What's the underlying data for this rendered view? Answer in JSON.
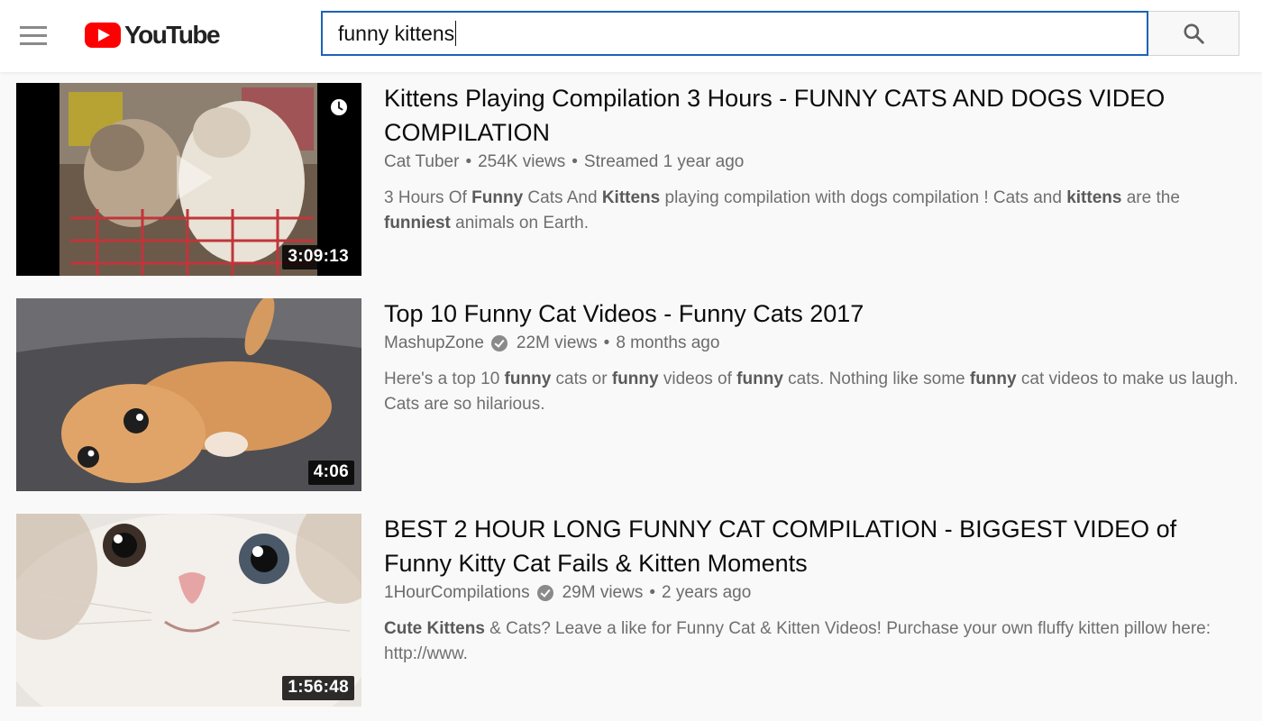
{
  "header": {
    "logo_text": "YouTube",
    "search_value": "funny kittens"
  },
  "results": [
    {
      "title": "Kittens Playing Compilation 3 Hours - FUNNY CATS AND DOGS VIDEO COMPILATION",
      "channel": "Cat Tuber",
      "verified": false,
      "views": "254K views",
      "age": "Streamed 1 year ago",
      "duration": "3:09:13",
      "description": [
        {
          "t": "3 Hours Of ",
          "b": false
        },
        {
          "t": "Funny",
          "b": true
        },
        {
          "t": " Cats And ",
          "b": false
        },
        {
          "t": "Kittens",
          "b": true
        },
        {
          "t": " playing compilation with dogs compilation ! Cats and ",
          "b": false
        },
        {
          "t": "kittens",
          "b": true
        },
        {
          "t": " are the ",
          "b": false
        },
        {
          "t": "funniest",
          "b": true
        },
        {
          "t": " animals on Earth.",
          "b": false
        }
      ]
    },
    {
      "title": "Top 10 Funny Cat Videos - Funny Cats 2017",
      "channel": "MashupZone",
      "verified": true,
      "views": "22M views",
      "age": "8 months ago",
      "duration": "4:06",
      "description": [
        {
          "t": "Here's a top 10 ",
          "b": false
        },
        {
          "t": "funny",
          "b": true
        },
        {
          "t": " cats or ",
          "b": false
        },
        {
          "t": "funny",
          "b": true
        },
        {
          "t": " videos of ",
          "b": false
        },
        {
          "t": "funny",
          "b": true
        },
        {
          "t": " cats. Nothing like some ",
          "b": false
        },
        {
          "t": "funny",
          "b": true
        },
        {
          "t": " cat videos to make us laugh. Cats are so hilarious.",
          "b": false
        }
      ]
    },
    {
      "title": "BEST 2 HOUR LONG FUNNY CAT COMPILATION - BIGGEST VIDEO of Funny Kitty Cat Fails & Kitten Moments",
      "channel": "1HourCompilations",
      "verified": true,
      "views": "29M views",
      "age": "2 years ago",
      "duration": "1:56:48",
      "description": [
        {
          "t": "Cute Kittens",
          "b": true
        },
        {
          "t": " & Cats? Leave a like for Funny Cat & Kitten Videos! Purchase your own fluffy kitten pillow here: http://www.",
          "b": false
        }
      ]
    }
  ],
  "icons": {
    "menu": "hamburger-menu-icon",
    "logo": "youtube-play-icon",
    "search": "magnifier-icon",
    "watch_later": "clock-icon",
    "verified": "check-circle-icon"
  },
  "colors": {
    "brand_red": "#ff0000",
    "search_border_focus": "#1c62b9",
    "page_bg": "#f9f9f9"
  }
}
